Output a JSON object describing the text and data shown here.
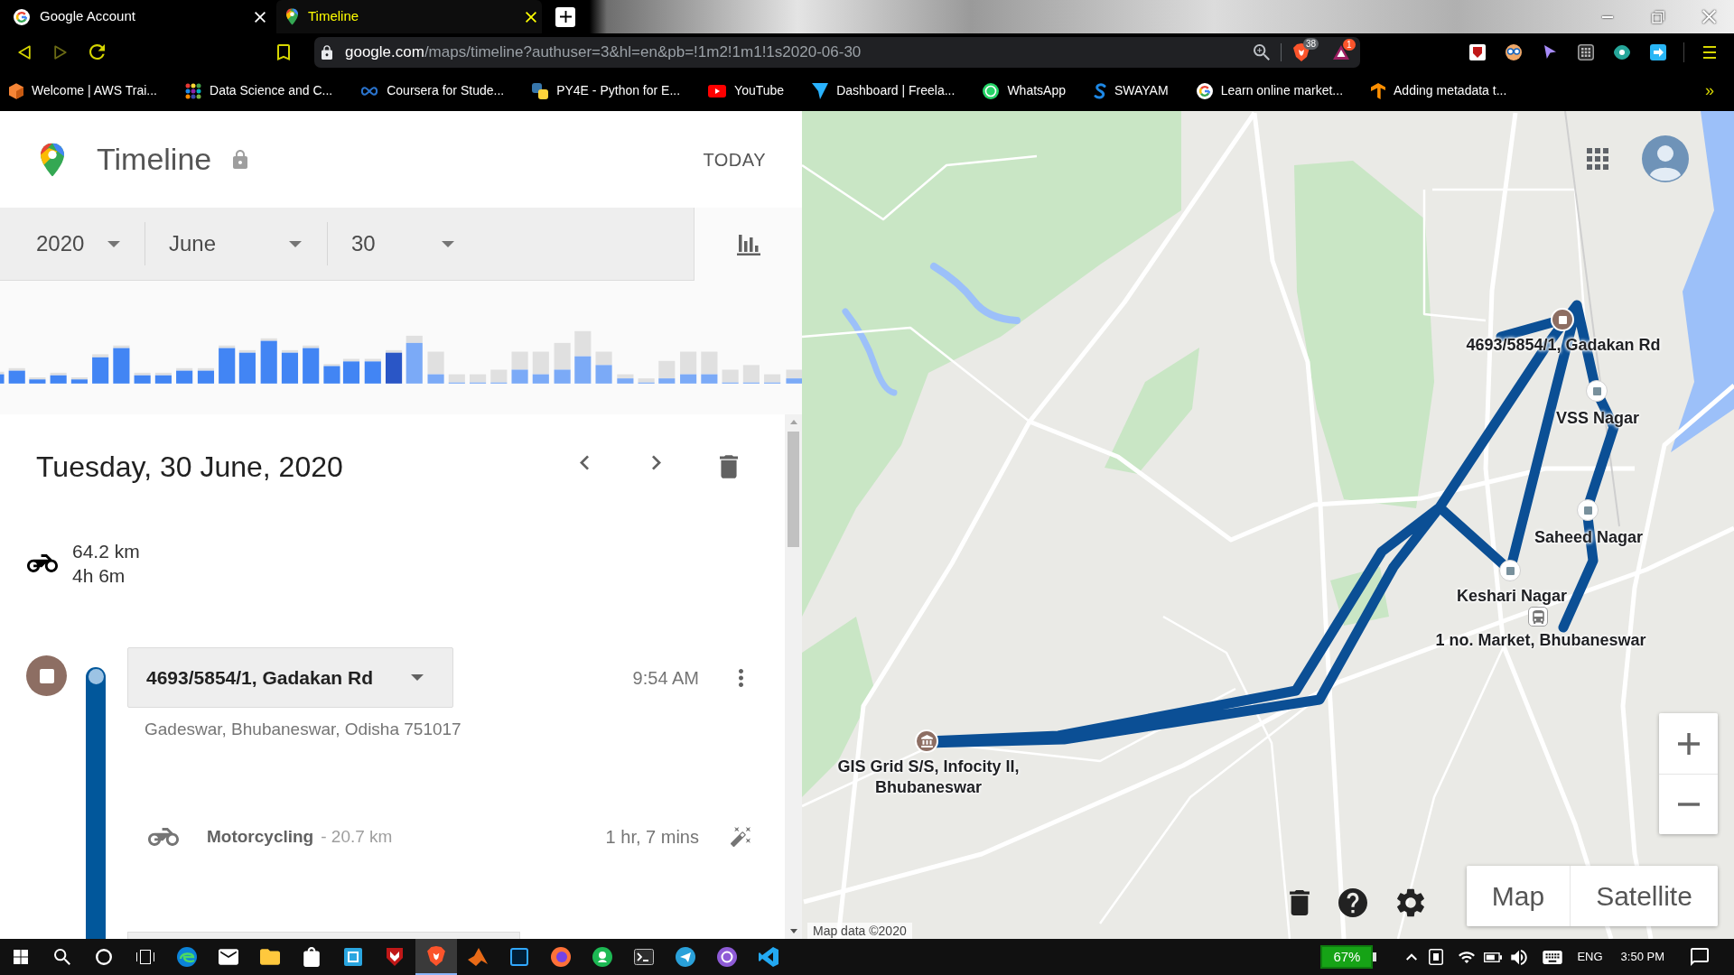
{
  "browser": {
    "tabs": [
      {
        "title": "Google Account",
        "selected": false
      },
      {
        "title": "Timeline",
        "selected": true
      }
    ],
    "forward_button": {
      "disabled": true
    },
    "address": {
      "host": "google.com",
      "path": "/maps/timeline?authuser=3&hl=en&pb=!1m2!1m1!1s2020-06-30"
    },
    "shields_count": "38",
    "rewards_count": "1",
    "bookmarks": [
      "Welcome | AWS Trai...",
      "Data Science and C...",
      "Coursera for Stude...",
      "PY4E - Python for E...",
      "YouTube",
      "Dashboard | Freela...",
      "WhatsApp",
      "SWAYAM",
      "Learn online market...",
      "Adding metadata t..."
    ],
    "bookmarks_more": "»"
  },
  "timeline": {
    "title": "Timeline",
    "today": "TODAY",
    "date_pickers": [
      "2020",
      "June",
      "30"
    ],
    "chart_button": {
      "selected": true
    },
    "activity_chart": {
      "bars": [
        {
          "selected": false
        },
        {
          "selected": false
        },
        {
          "selected": false
        },
        {
          "selected": false
        },
        {
          "selected": false
        },
        {
          "selected": false
        },
        {
          "selected": false
        },
        {
          "selected": false
        },
        {
          "selected": false
        },
        {
          "selected": false
        },
        {
          "selected": false
        },
        {
          "selected": false
        },
        {
          "selected": false
        },
        {
          "selected": false
        },
        {
          "selected": false
        },
        {
          "selected": false
        },
        {
          "selected": false
        },
        {
          "selected": false
        },
        {
          "selected": false
        },
        {
          "selected": true
        },
        {
          "selected": false
        },
        {
          "selected": false
        },
        {
          "selected": false
        },
        {
          "selected": false
        },
        {
          "selected": false
        },
        {
          "selected": false
        },
        {
          "selected": false
        },
        {
          "selected": false
        },
        {
          "selected": false
        },
        {
          "selected": false
        },
        {
          "selected": false
        },
        {
          "selected": false
        },
        {
          "selected": false
        },
        {
          "selected": false
        },
        {
          "selected": false
        },
        {
          "selected": false
        },
        {
          "selected": false
        },
        {
          "selected": false
        },
        {
          "selected": false
        }
      ]
    },
    "date_heading": "Tuesday, 30 June, 2020",
    "summary": {
      "distance": "64.2 km",
      "duration": "4h 6m"
    },
    "entries": [
      {
        "kind": "place",
        "name": "4693/5854/1, Gadakan Rd",
        "time": "9:54 AM",
        "address": "Gadeswar, Bhubaneswar, Odisha 751017"
      },
      {
        "kind": "activity",
        "activity": "Motorcycling",
        "distance": "- 20.7 km",
        "duration": "1 hr, 7 mins"
      }
    ]
  },
  "map": {
    "places": [
      {
        "kind": "stop",
        "label": "4693/5854/1, Gadakan Rd"
      },
      {
        "kind": "visit",
        "label": "VSS Nagar"
      },
      {
        "kind": "visit",
        "label": "Saheed Nagar"
      },
      {
        "kind": "visit",
        "label": "Keshari Nagar"
      },
      {
        "kind": "transit",
        "label": "1 no. Market, Bhubaneswar"
      },
      {
        "kind": "building",
        "label": "GIS Grid S/S, Infocity II, Bhubaneswar"
      }
    ],
    "map_types": [
      "Map",
      "Satellite"
    ],
    "attribution": "Map data ©2020"
  },
  "taskbar": {
    "apps": [
      {
        "selected": false
      },
      {
        "selected": false
      },
      {
        "selected": false
      },
      {
        "selected": false
      },
      {
        "selected": false
      },
      {
        "selected": false
      },
      {
        "selected": true
      },
      {
        "selected": false
      },
      {
        "selected": false
      },
      {
        "selected": false
      },
      {
        "selected": false
      },
      {
        "selected": false
      },
      {
        "selected": false
      },
      {
        "selected": false
      },
      {
        "selected": false
      }
    ],
    "battery": "67%",
    "language": "ENG",
    "time": "3:50 PM"
  }
}
